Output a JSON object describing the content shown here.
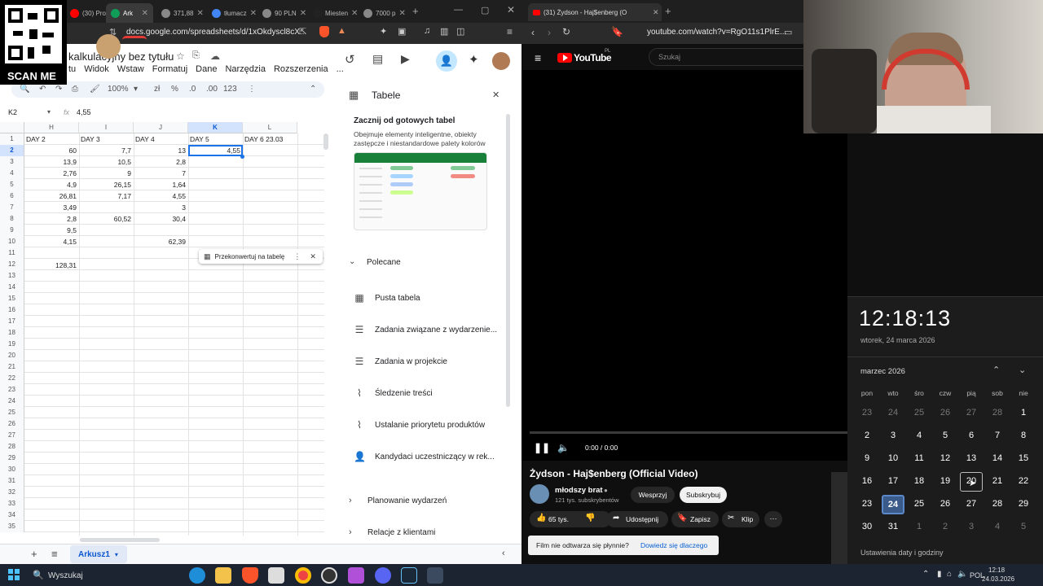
{
  "left_browser": {
    "tabs": [
      {
        "label": "(30) Pro"
      },
      {
        "label": "Ark"
      },
      {
        "label": "371,88"
      },
      {
        "label": "tłumacz"
      },
      {
        "label": "90 PLN"
      },
      {
        "label": "Miesten"
      },
      {
        "label": "7000 p"
      }
    ],
    "new_tab": "+",
    "url": "docs.google.com/spreadsheets/d/1xOkdyscl8cX..."
  },
  "qr": {
    "label": "SCAN ME"
  },
  "sheets": {
    "title": "kalkulacyjny bez tytułu",
    "menu": [
      "tu",
      "Widok",
      "Wstaw",
      "Formatuj",
      "Dane",
      "Narzędzia",
      "Rozszerzenia",
      "..."
    ],
    "zoom": "100%",
    "toolbar": {
      "currency": "zł",
      "percent": "%",
      "dec_less": ".0",
      "dec_more": ".00",
      "format": "123"
    },
    "cell_ref": "K2",
    "formula": "4,55",
    "col_headers": [
      "H",
      "I",
      "J",
      "K",
      "L"
    ],
    "row_numbers": [
      "1",
      "2",
      "3",
      "4",
      "5",
      "6",
      "7",
      "8",
      "9",
      "10",
      "11",
      "12",
      "13",
      "14",
      "15",
      "16",
      "17",
      "18",
      "19",
      "20",
      "21",
      "22",
      "23",
      "24",
      "25",
      "26",
      "27",
      "28",
      "29",
      "30",
      "31",
      "32",
      "33",
      "34",
      "35"
    ],
    "header_row": [
      "DAY 2",
      "DAY 3",
      "DAY 4",
      "DAY 5",
      "DAY 6 23.03"
    ],
    "rows": [
      [
        "60",
        "7,7",
        "13",
        "4,55"
      ],
      [
        "13,9",
        "10,5",
        "2,8",
        ""
      ],
      [
        "2,76",
        "9",
        "7",
        ""
      ],
      [
        "4,9",
        "26,15",
        "1,64",
        ""
      ],
      [
        "26,81",
        "7,17",
        "4,55",
        ""
      ],
      [
        "3,49",
        "",
        "3",
        ""
      ],
      [
        "2,8",
        "60,52",
        "30,4",
        ""
      ],
      [
        "9,5",
        "",
        "",
        ""
      ],
      [
        "4,15",
        "",
        "62,39",
        ""
      ]
    ],
    "sum_h": "128,31",
    "convert_chip": "Przekonwertuj na tabelę",
    "sheet_tab": "Arkusz1"
  },
  "tables_panel": {
    "title": "Tabele",
    "start_heading": "Zacznij od gotowych tabel",
    "start_desc": "Obejmuje elementy inteligentne, obiekty zastępcze i niestandardowe palety kolorów",
    "recommended": "Polecane",
    "items": [
      {
        "label": "Pusta tabela",
        "icon": "table-icon"
      },
      {
        "label": "Zadania związane z wydarzenie...",
        "icon": "checklist-icon"
      },
      {
        "label": "Zadania w projekcie",
        "icon": "checklist-icon"
      },
      {
        "label": "Śledzenie treści",
        "icon": "trend-icon"
      },
      {
        "label": "Ustalanie priorytetu produktów",
        "icon": "trend-icon"
      },
      {
        "label": "Kandydaci uczestniczący w rek...",
        "icon": "person-icon"
      }
    ],
    "sections": [
      "Planowanie wydarzeń",
      "Relacje z klientami"
    ]
  },
  "right_browser": {
    "tab_label": "(31) Żydson - Haj$enberg (O",
    "new_tab": "+",
    "url": "youtube.com/watch?v=RgO11s1PlrE..."
  },
  "youtube": {
    "logo": "YouTube",
    "logo_sup": "PL",
    "search_placeholder": "Szukaj",
    "time": "0:00 / 0:00",
    "video_title": "Żydson - Haj$enberg (Official Video)",
    "channel": "młodszy brat",
    "subs": "121 tys. subskrybentów",
    "support": "Wesprzyj",
    "subscribe": "Subskrybuj",
    "likes": "65 tys.",
    "share": "Udostępnij",
    "save": "Zapisz",
    "clip": "Klip",
    "more": "···",
    "notice": "Film nie odtwarza się płynnie?",
    "notice_link": "Dowiedz się dlaczego"
  },
  "calendar": {
    "time": "12:18:13",
    "date": "wtorek, 24 marca 2026",
    "month": "marzec 2026",
    "dow": [
      "pon",
      "wto",
      "śro",
      "czw",
      "pią",
      "sob",
      "nie"
    ],
    "weeks": [
      [
        "23",
        "24",
        "25",
        "26",
        "27",
        "28",
        "1"
      ],
      [
        "2",
        "3",
        "4",
        "5",
        "6",
        "7",
        "8"
      ],
      [
        "9",
        "10",
        "11",
        "12",
        "13",
        "14",
        "15"
      ],
      [
        "16",
        "17",
        "18",
        "19",
        "20",
        "21",
        "22"
      ],
      [
        "23",
        "24",
        "25",
        "26",
        "27",
        "28",
        "29"
      ],
      [
        "30",
        "31",
        "1",
        "2",
        "3",
        "4",
        "5"
      ]
    ],
    "footer": "Ustawienia daty i godziny"
  },
  "taskbar": {
    "search": "Wyszukaj",
    "lang": "POL",
    "clock": "12:18",
    "date": "24.03.2026"
  }
}
